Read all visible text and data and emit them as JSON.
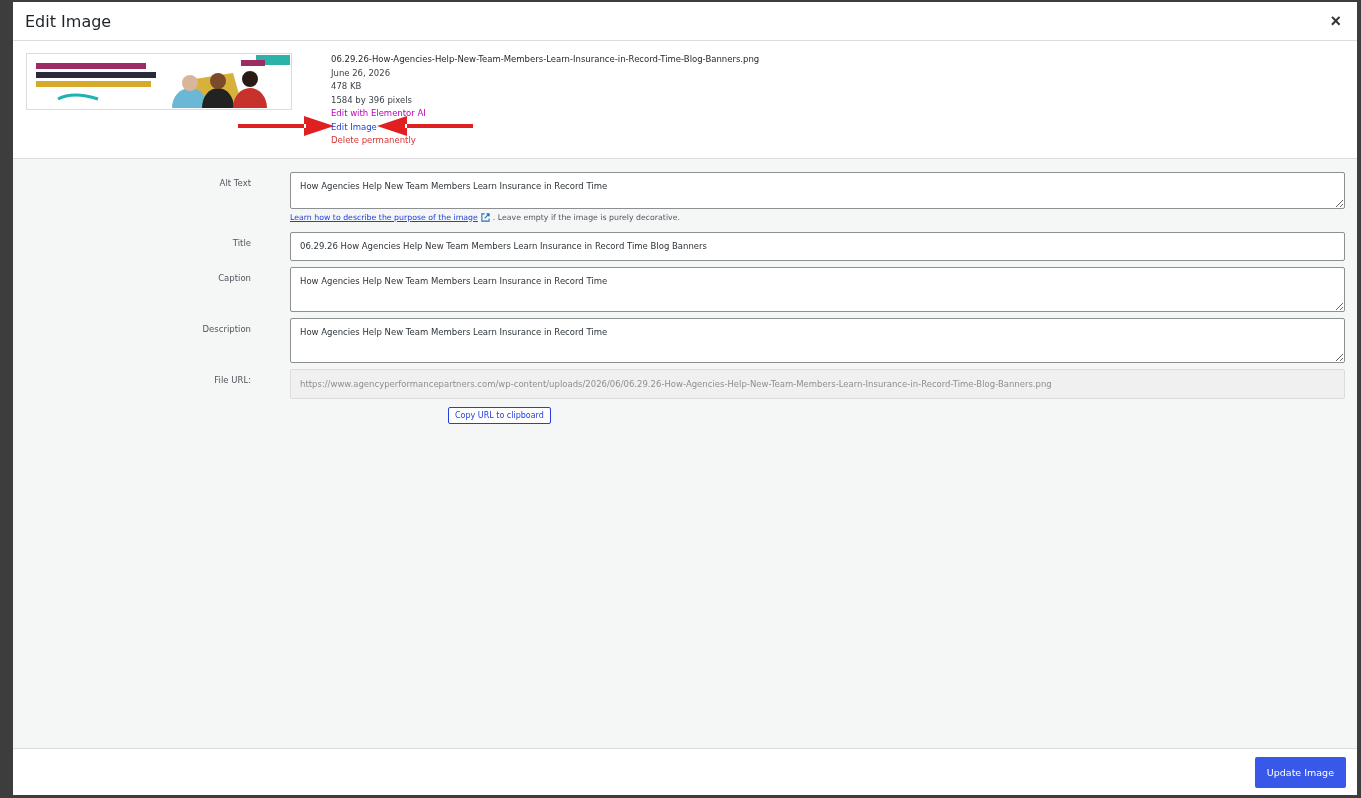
{
  "dialog": {
    "title": "Edit Image",
    "close": "×"
  },
  "attachment": {
    "filename": "06.29.26-How-Agencies-Help-New-Team-Members-Learn-Insurance-in-Record-Time-Blog-Banners.png",
    "details": [
      "June 26, 2026",
      "478 KB",
      "1584 by 396 pixels"
    ],
    "actions": [
      {
        "label": "Edit with Elementor AI",
        "kind": "ai"
      },
      {
        "label": "Edit Image",
        "kind": "edit"
      },
      {
        "label": "Delete permanently",
        "kind": "delete"
      }
    ]
  },
  "annotations": [
    {
      "kind": "arrow-right"
    },
    {
      "kind": "arrow-left"
    }
  ],
  "fields": [
    {
      "label": "Alt Text",
      "kind": "textarea",
      "value": "How Agencies Help New Team Members Learn Insurance in Record Time",
      "help": {
        "link": "Learn how to describe the purpose of the image",
        "text": ". Leave empty if the image is purely decorative."
      }
    },
    {
      "label": "Title",
      "kind": "input",
      "value": "06.29.26 How Agencies Help New Team Members Learn Insurance in Record Time Blog Banners"
    },
    {
      "label": "Caption",
      "kind": "textarea",
      "value": "How Agencies Help New Team Members Learn Insurance in Record Time"
    },
    {
      "label": "Description",
      "kind": "textarea",
      "value": "How Agencies Help New Team Members Learn Insurance in Record Time"
    },
    {
      "label": "File URL:",
      "kind": "readonly",
      "value": "https://www.agencyperformancepartners.com/wp-content/uploads/2026/06/06.29.26-How-Agencies-Help-New-Team-Members-Learn-Insurance-in-Record-Time-Blog-Banners.png",
      "button": "Copy URL to clipboard"
    }
  ],
  "footer": {
    "button": "Update Image"
  }
}
